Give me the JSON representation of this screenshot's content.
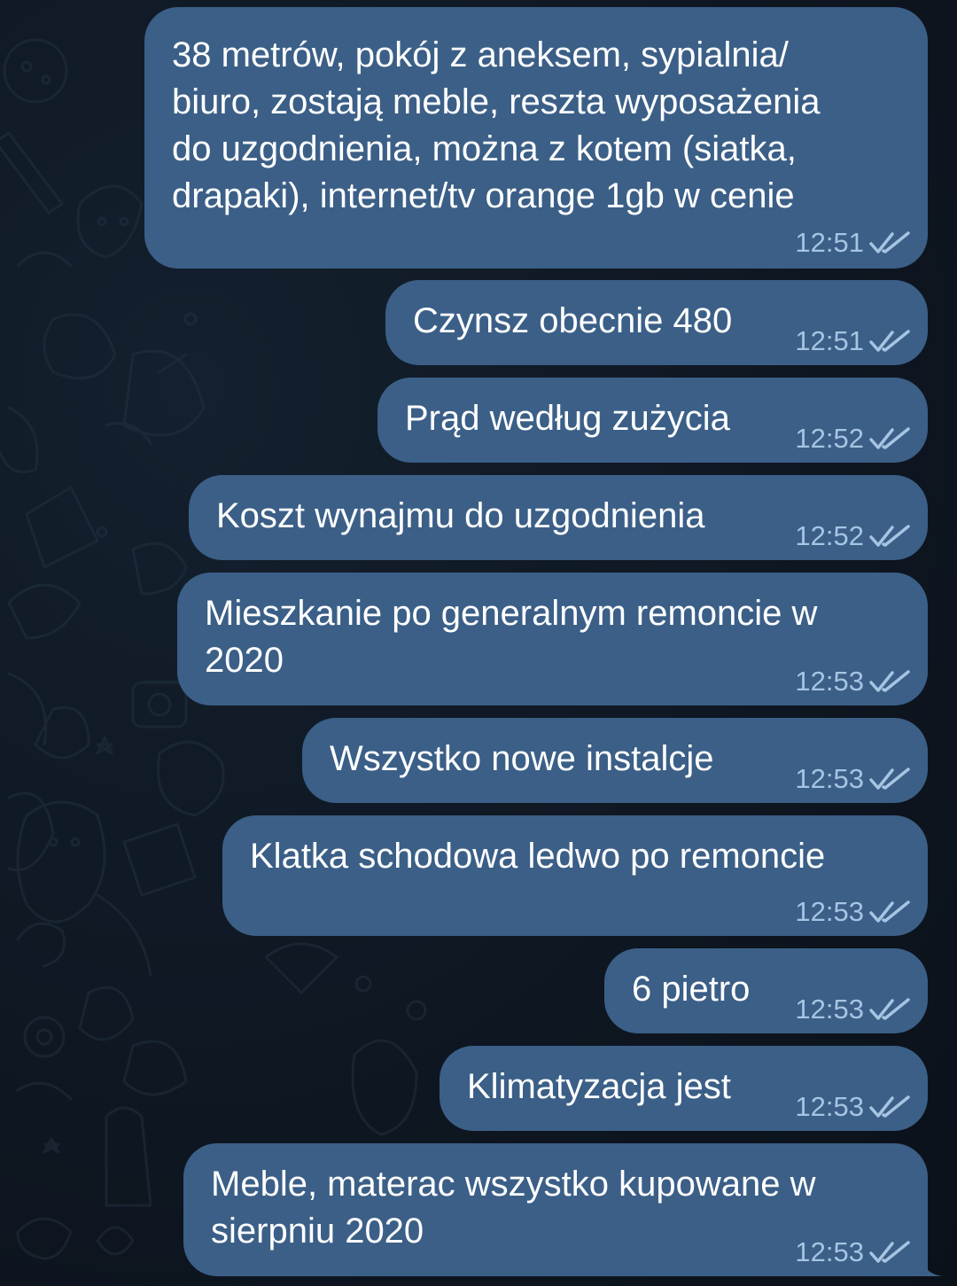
{
  "chat": {
    "messages": [
      {
        "text": "38 metrów, pokój z aneksem, sypialnia/\nbiuro, zostają meble, reszta wyposażenia\ndo uzgodnienia, można z kotem (siatka,\ndrapaki), internet/tv orange 1gb w cenie",
        "time": "12:51",
        "status": "read"
      },
      {
        "text": "Czynsz obecnie 480",
        "time": "12:51",
        "status": "read"
      },
      {
        "text": "Prąd według zużycia",
        "time": "12:52",
        "status": "read"
      },
      {
        "text": "Koszt wynajmu do uzgodnienia",
        "time": "12:52",
        "status": "read"
      },
      {
        "text": "Mieszkanie po generalnym remoncie w\n2020",
        "time": "12:53",
        "status": "read"
      },
      {
        "text": "Wszystko nowe instalcje",
        "time": "12:53",
        "status": "read"
      },
      {
        "text": "Klatka schodowa ledwo po remoncie",
        "time": "12:53",
        "status": "read"
      },
      {
        "text": "6 pietro",
        "time": "12:53",
        "status": "read"
      },
      {
        "text": "Klimatyzacja jest",
        "time": "12:53",
        "status": "read"
      },
      {
        "text": "Meble, materac wszystko kupowane w\nsierpniu 2020",
        "time": "12:53",
        "status": "read"
      }
    ]
  },
  "icons": {
    "read_status": "double-check-icon",
    "background": "doodle-pattern"
  },
  "colors": {
    "background": "#0e1621",
    "outgoing_bubble": "#3b5f87",
    "message_text": "#ffffff",
    "meta_text": "#a7c4e2"
  }
}
